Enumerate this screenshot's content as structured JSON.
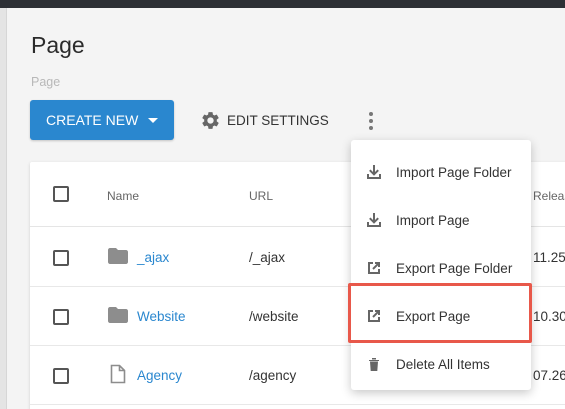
{
  "header": {
    "title": "Page",
    "breadcrumb": "Page"
  },
  "toolbar": {
    "create_label": "CREATE NEW",
    "edit_label": "EDIT SETTINGS"
  },
  "table": {
    "columns": [
      "Name",
      "URL",
      "Releas"
    ],
    "rows": [
      {
        "name": "_ajax",
        "url": "/_ajax",
        "release": "11.25",
        "type": "folder"
      },
      {
        "name": "Website",
        "url": "/website",
        "release": "10.30",
        "type": "folder"
      },
      {
        "name": "Agency",
        "url": "/agency",
        "release": "07.26",
        "type": "page"
      }
    ]
  },
  "menu": {
    "items": [
      {
        "label": "Import Page Folder",
        "icon": "download-icon"
      },
      {
        "label": "Import Page",
        "icon": "download-icon"
      },
      {
        "label": "Export Page Folder",
        "icon": "external-link-icon"
      },
      {
        "label": "Export Page",
        "icon": "external-link-icon"
      },
      {
        "label": "Delete All Items",
        "icon": "trash-icon"
      }
    ]
  },
  "colors": {
    "accent": "#2a87cf",
    "highlight": "#e8584a"
  }
}
